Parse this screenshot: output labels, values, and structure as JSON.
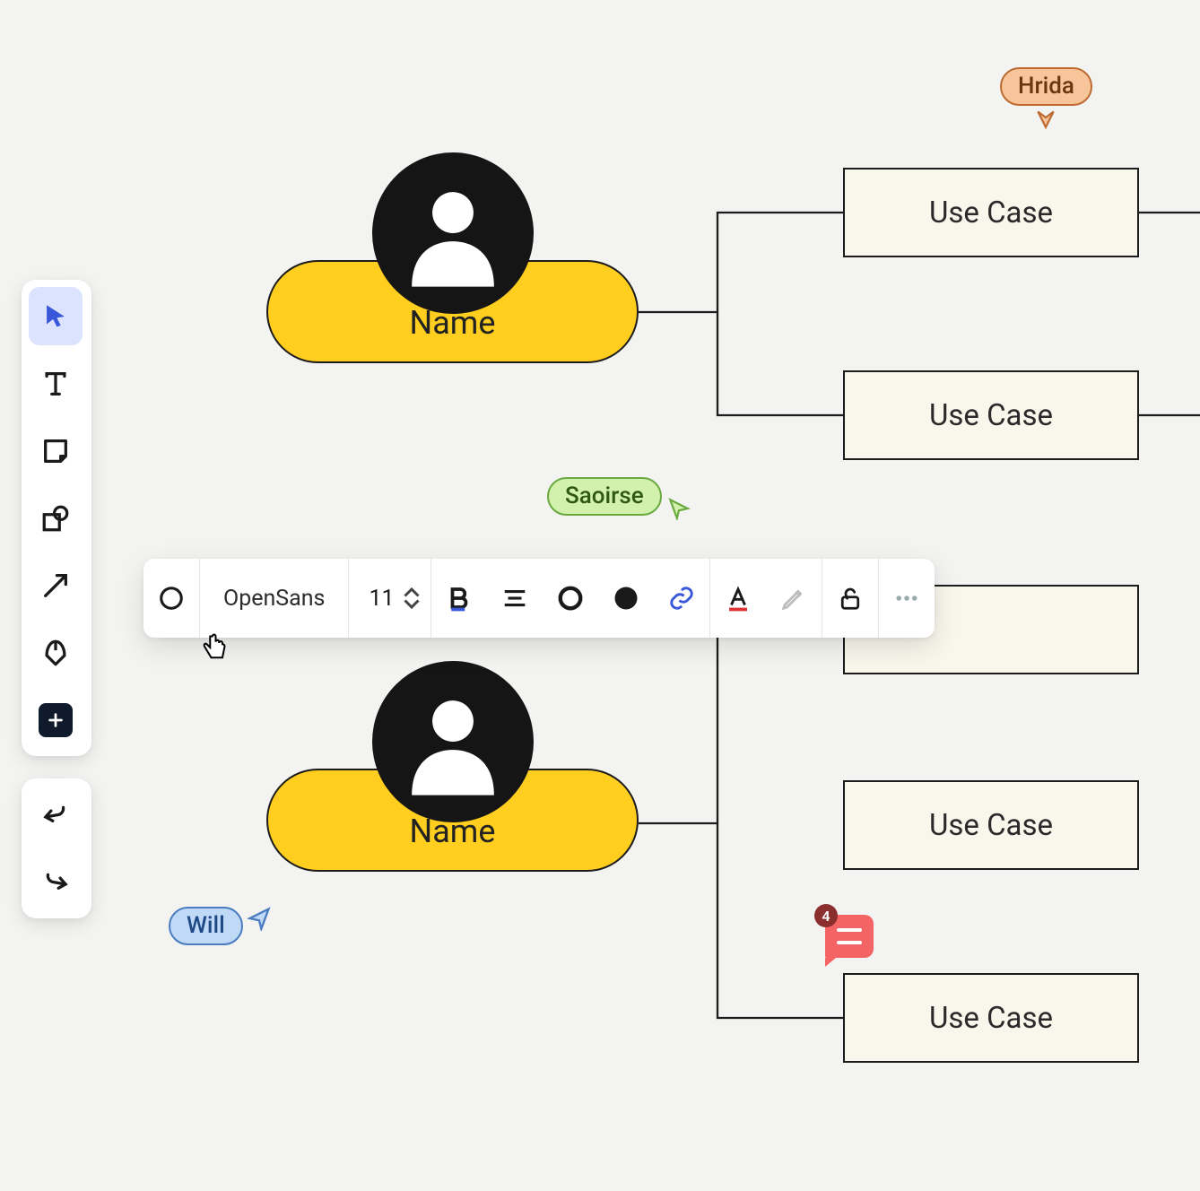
{
  "actors": [
    {
      "label": "Name"
    },
    {
      "label": "Name"
    }
  ],
  "usecases": [
    {
      "label": "Use Case"
    },
    {
      "label": "Use Case"
    },
    {
      "label": "Use Case"
    },
    {
      "label": "Use Case"
    }
  ],
  "collaborators": {
    "hrida": {
      "name": "Hrida"
    },
    "saoirse": {
      "name": "Saoirse"
    },
    "will": {
      "name": "Will"
    }
  },
  "comment": {
    "count": "4"
  },
  "format_toolbar": {
    "font": "OpenSans",
    "size": "11"
  },
  "left_toolbar": {
    "tools": [
      "select",
      "text",
      "note",
      "shapes",
      "line-arrow",
      "pen",
      "plus"
    ],
    "history": [
      "undo",
      "redo"
    ]
  }
}
